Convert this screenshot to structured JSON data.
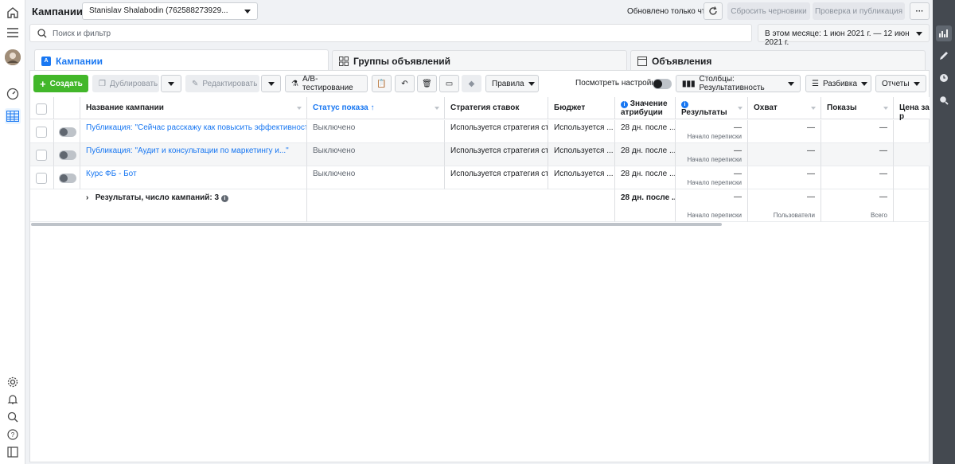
{
  "header": {
    "title": "Кампании",
    "account": "Stanislav Shalabodin (762588273929...",
    "updated": "Обновлено только что",
    "discard": "Сбросить черновики",
    "review": "Проверка и публикация",
    "more": "···"
  },
  "search": {
    "placeholder": "Поиск и фильтр",
    "date_range": "В этом месяце: 1 июн 2021 г. — 12 июн 2021 г."
  },
  "tabs": [
    {
      "label": "Кампании"
    },
    {
      "label": "Группы объявлений"
    },
    {
      "label": "Объявления"
    }
  ],
  "toolbar": {
    "create": "Создать",
    "duplicate": "Дублировать",
    "edit": "Редактировать",
    "ab_test": "A/B-тестирование",
    "rules": "Правила",
    "view_settings": "Посмотреть настройки",
    "columns": "Столбцы: Результативность",
    "breakdown": "Разбивка",
    "reports": "Отчеты"
  },
  "columns": [
    "Название кампании",
    "Статус показа",
    "Стратегия ставок",
    "Бюджет",
    "Значение атрибуции",
    "Результаты",
    "Охват",
    "Показы",
    "Цена за р"
  ],
  "rows": [
    {
      "name": "Публикация: \"Сейчас расскажу как повысить эффективность...\"",
      "status": "Выключено",
      "strategy": "Используется стратегия ст...",
      "budget": "Используется ...",
      "attribution": "28 дн. после ...",
      "results": "—",
      "results_sub": "Начало переписки",
      "reach": "—",
      "impressions": "—"
    },
    {
      "name": "Публикация: \"Аудит и консультации по маркетингу и...\"",
      "status": "Выключено",
      "strategy": "Используется стратегия ст...",
      "budget": "Используется ...",
      "attribution": "28 дн. после ...",
      "results": "—",
      "results_sub": "Начало переписки",
      "reach": "—",
      "impressions": "—"
    },
    {
      "name": "Курс ФБ - Бот",
      "status": "Выключено",
      "strategy": "Используется стратегия ст...",
      "budget": "Используется ...",
      "attribution": "28 дн. после ...",
      "results": "—",
      "results_sub": "Начало переписки",
      "reach": "—",
      "impressions": "—"
    }
  ],
  "summary": {
    "label": "Результаты, число кампаний: 3",
    "attribution": "28 дн. после ...",
    "results": "—",
    "results_sub": "Начало переписки",
    "reach": "—",
    "reach_sub": "Пользователи",
    "impressions": "—",
    "impressions_sub": "Всего"
  }
}
